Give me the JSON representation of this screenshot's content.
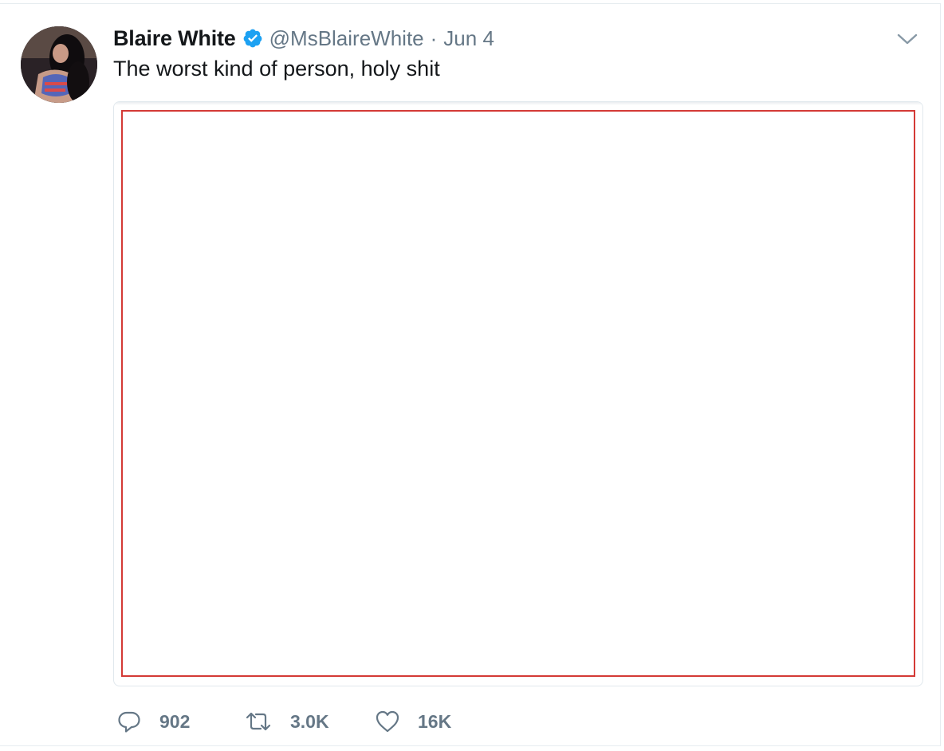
{
  "tweet": {
    "author_name": "Blaire White",
    "author_handle": "@MsBlaireWhite",
    "separator": "·",
    "date": "Jun 4",
    "text": "The worst kind of person, holy shit",
    "verified": true
  },
  "actions": {
    "reply_count": "902",
    "retweet_count": "3.0K",
    "like_count": "16K"
  },
  "icons": {
    "verified": "verified-badge-icon",
    "caret": "chevron-down-icon",
    "reply": "reply-icon",
    "retweet": "retweet-icon",
    "like": "heart-icon"
  },
  "colors": {
    "text_primary": "#14171a",
    "text_secondary": "#657786",
    "verified_blue": "#1da1f2",
    "media_highlight_border": "#d43a36",
    "divider": "#e6ecf0"
  }
}
